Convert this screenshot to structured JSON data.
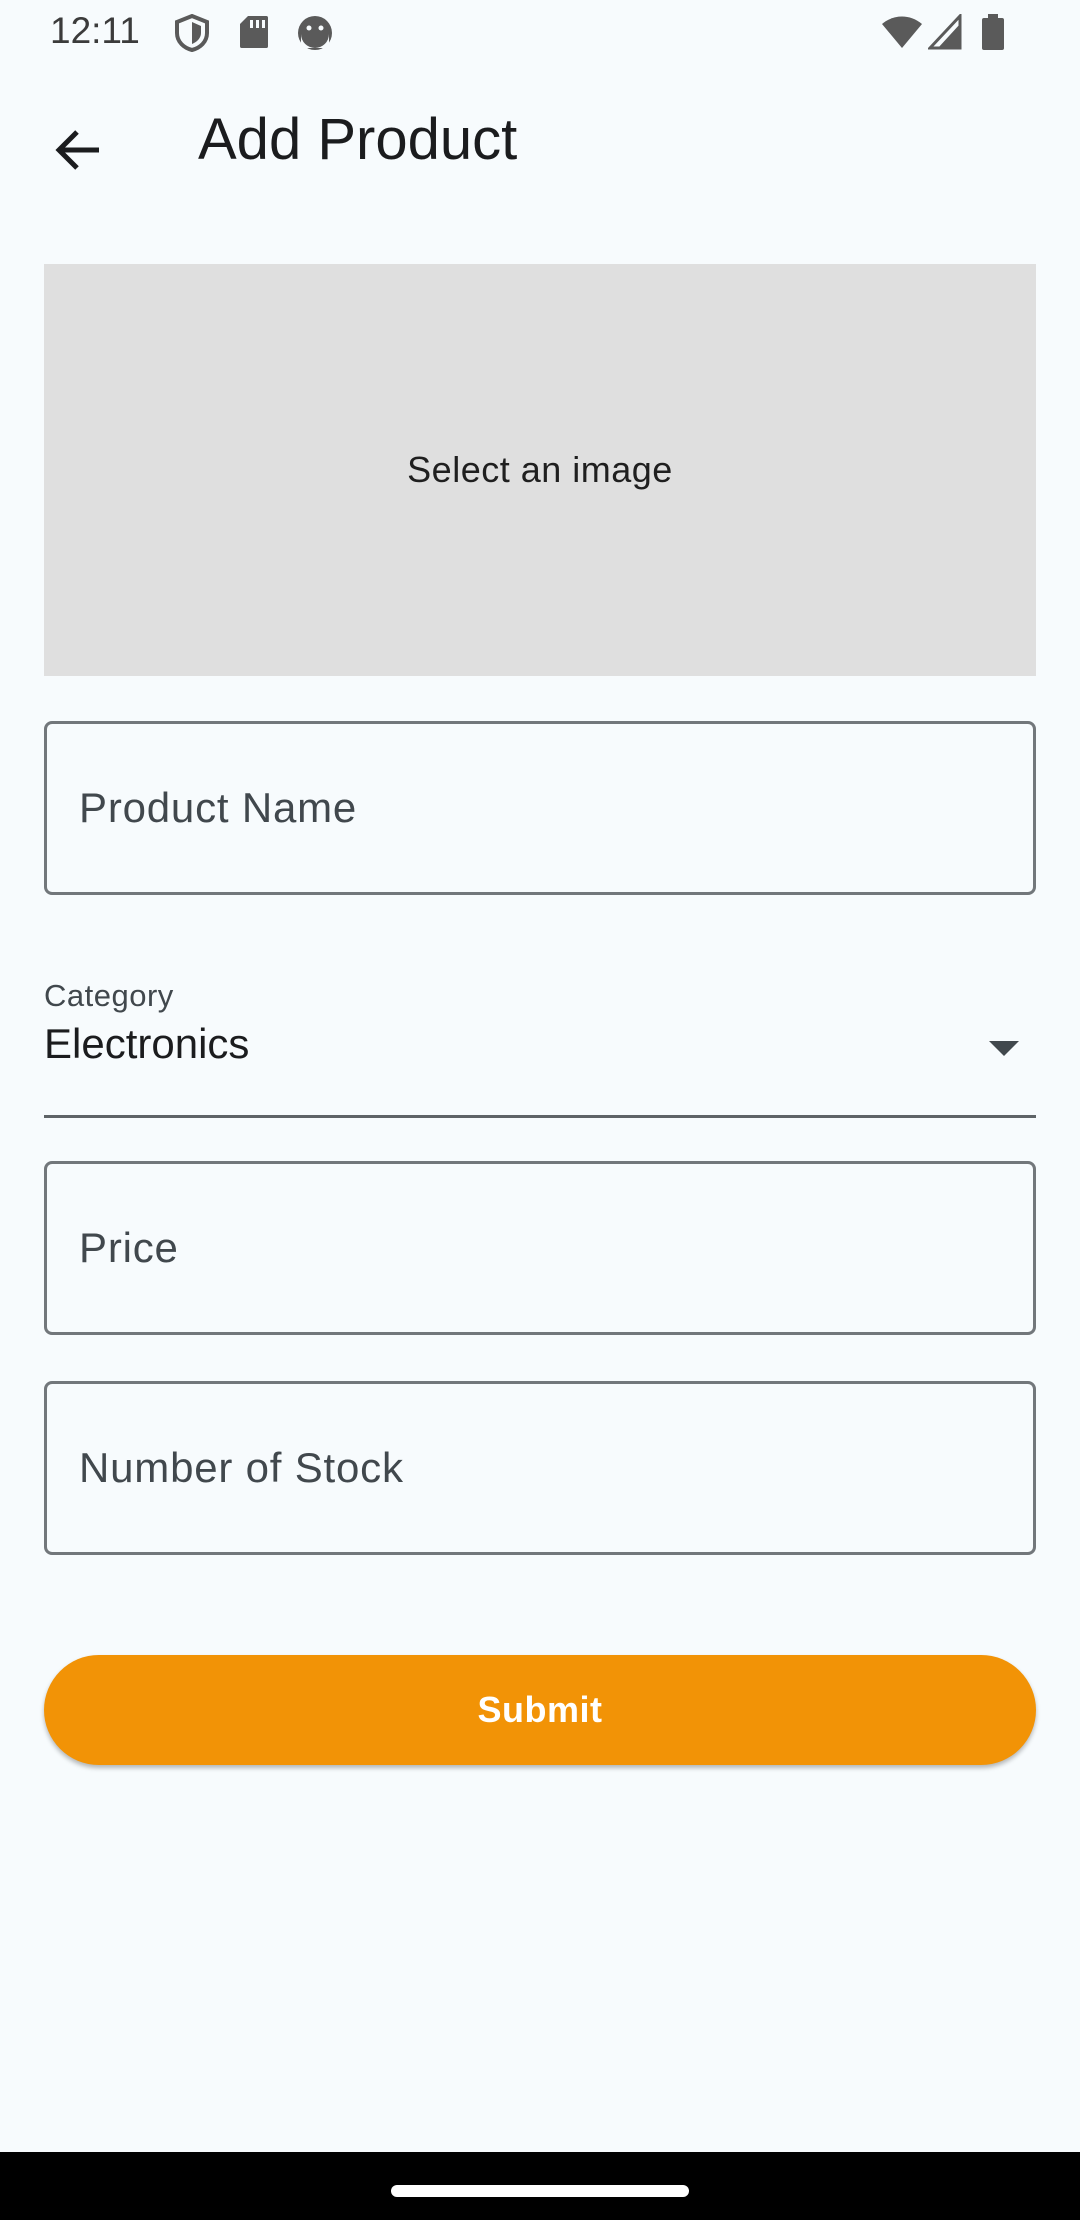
{
  "status_bar": {
    "time": "12:11",
    "left_icons": [
      "shield-icon",
      "sd-card-icon",
      "android-face-icon"
    ],
    "right_icons": [
      "wifi-icon",
      "signal-icon",
      "battery-icon"
    ]
  },
  "app_bar": {
    "title": "Add Product",
    "back_icon": "arrow-back-icon"
  },
  "image_picker": {
    "label": "Select an image"
  },
  "form": {
    "product_name": {
      "placeholder": "Product Name",
      "value": ""
    },
    "category": {
      "label": "Category",
      "value": "Electronics"
    },
    "price": {
      "placeholder": "Price",
      "value": ""
    },
    "stock": {
      "placeholder": "Number of Stock",
      "value": ""
    },
    "submit_label": "Submit"
  },
  "colors": {
    "background": "#f7fbfd",
    "accent": "#f29306",
    "image_placeholder_bg": "#dfdfdf",
    "outline": "#72777b"
  }
}
